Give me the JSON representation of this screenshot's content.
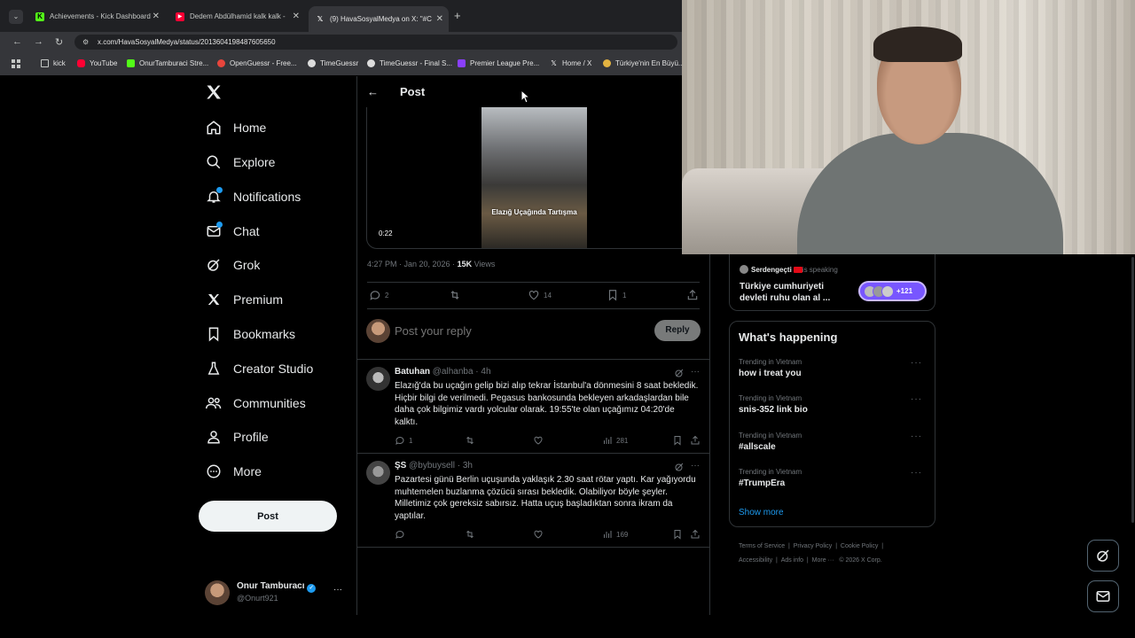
{
  "browser": {
    "tabs": [
      {
        "title": "Achievements - Kick Dashboard",
        "favicon_color": "#53fc18",
        "favicon_glyph": "K"
      },
      {
        "title": "Dedem Abdülhamid kalk kalk -",
        "favicon_color": "#ff0033",
        "favicon_glyph": "▶"
      },
      {
        "title": "(9) HavaSosyalMedya on X: \"#C",
        "favicon_color": "#000000",
        "favicon_glyph": "X",
        "active": true
      }
    ],
    "new_tab": "+",
    "url": "x.com/HavaSosyalMedya/status/2013604198487605650",
    "bookmarks": [
      {
        "label": "kick",
        "icon": "folder-icon",
        "color": "#c4c7c5"
      },
      {
        "label": "YouTube",
        "icon": "youtube-icon",
        "color": "#ff0033"
      },
      {
        "label": "OnurTamburaci Stre...",
        "icon": "kick-icon",
        "color": "#53fc18"
      },
      {
        "label": "OpenGuessr - Free...",
        "icon": "openguessr-icon",
        "color": "#e8453c"
      },
      {
        "label": "TimeGuessr",
        "icon": "timeguessr-icon",
        "color": "#dddddd"
      },
      {
        "label": "TimeGuessr - Final S...",
        "icon": "timeguessr-icon",
        "color": "#dddddd"
      },
      {
        "label": "Premier League Pre...",
        "icon": "premier-league-icon",
        "color": "#8a3ffc"
      },
      {
        "label": "Home / X",
        "icon": "x-icon",
        "color": "#ffffff"
      },
      {
        "label": "Türkiye'nin En Büyü...",
        "icon": "site-icon",
        "color": "#e3b341"
      }
    ]
  },
  "sidebar": {
    "items": [
      {
        "label": "Home",
        "icon": "home-icon"
      },
      {
        "label": "Explore",
        "icon": "search-icon"
      },
      {
        "label": "Notifications",
        "icon": "bell-icon"
      },
      {
        "label": "Chat",
        "icon": "mail-icon"
      },
      {
        "label": "Grok",
        "icon": "grok-icon"
      },
      {
        "label": "Premium",
        "icon": "x-icon"
      },
      {
        "label": "Bookmarks",
        "icon": "bookmark-icon"
      },
      {
        "label": "Creator Studio",
        "icon": "flask-icon"
      },
      {
        "label": "Communities",
        "icon": "communities-icon"
      },
      {
        "label": "Profile",
        "icon": "person-icon"
      },
      {
        "label": "More",
        "icon": "more-circle-icon"
      }
    ],
    "post_button": "Post",
    "user": {
      "name": "Onur Tamburacı",
      "handle": "@Onurt921"
    }
  },
  "post": {
    "header": "Post",
    "video": {
      "caption": "Elazığ Uçağında Tartışma",
      "duration": "0:22"
    },
    "meta": {
      "time": "4:27 PM · Jan 20, 2026 · ",
      "views": "15K",
      "views_label": " Views"
    },
    "actions": {
      "replies": "2",
      "retweets": "",
      "likes": "14",
      "bookmarks": "1"
    },
    "reply_placeholder": "Post your reply",
    "reply_button": "Reply"
  },
  "replies": [
    {
      "name": "Batuhan",
      "handle": "@alhanba · 4h",
      "text": "Elazığ'da bu uçağın gelip bizi alıp tekrar İstanbul'a dönmesini 8 saat bekledik. Hiçbir bilgi de verilmedi. Pegasus bankosunda bekleyen arkadaşlardan bile daha çok bilgimiz vardı yolcular olarak. 19:55'te olan uçağımız 04:20'de kalktı.",
      "replies": "1",
      "views": "281"
    },
    {
      "name": "ŞS",
      "handle": "@bybuysell · 3h",
      "text": "Pazartesi günü Berlin uçuşunda yaklaşık 2.30 saat rötar yaptı. Kar yağıyordu muhtemelen buzlanma çözücü sırası bekledik. Olabiliyor böyle şeyler. Milletimiz çok gereksiz sabırsız. Hatta uçuş başladıktan sonra ikram da yaptılar.",
      "replies": "",
      "views": "169"
    }
  ],
  "space": {
    "host": "Serdengeçti",
    "status": " is speaking",
    "title": "Türkiye cumhuriyeti devleti ruhu olan al ...",
    "listeners": "+121"
  },
  "whats_happening": {
    "title": "What's happening",
    "trends": [
      {
        "context": "Trending in Vietnam",
        "topic": "how i treat you"
      },
      {
        "context": "Trending in Vietnam",
        "topic": "snis-352 link bio"
      },
      {
        "context": "Trending in Vietnam",
        "topic": "#allscale"
      },
      {
        "context": "Trending in Vietnam",
        "topic": "#TrumpEra"
      }
    ],
    "show_more": "Show more"
  },
  "footer": {
    "links": [
      "Terms of Service",
      "Privacy Policy",
      "Cookie Policy",
      "Accessibility",
      "Ads info",
      "More ···",
      "© 2026 X Corp."
    ]
  },
  "colors": {
    "accent": "#1d9bf0",
    "background": "#000000",
    "text": "#e7e9ea",
    "muted": "#71767b",
    "border": "#2f3336"
  }
}
